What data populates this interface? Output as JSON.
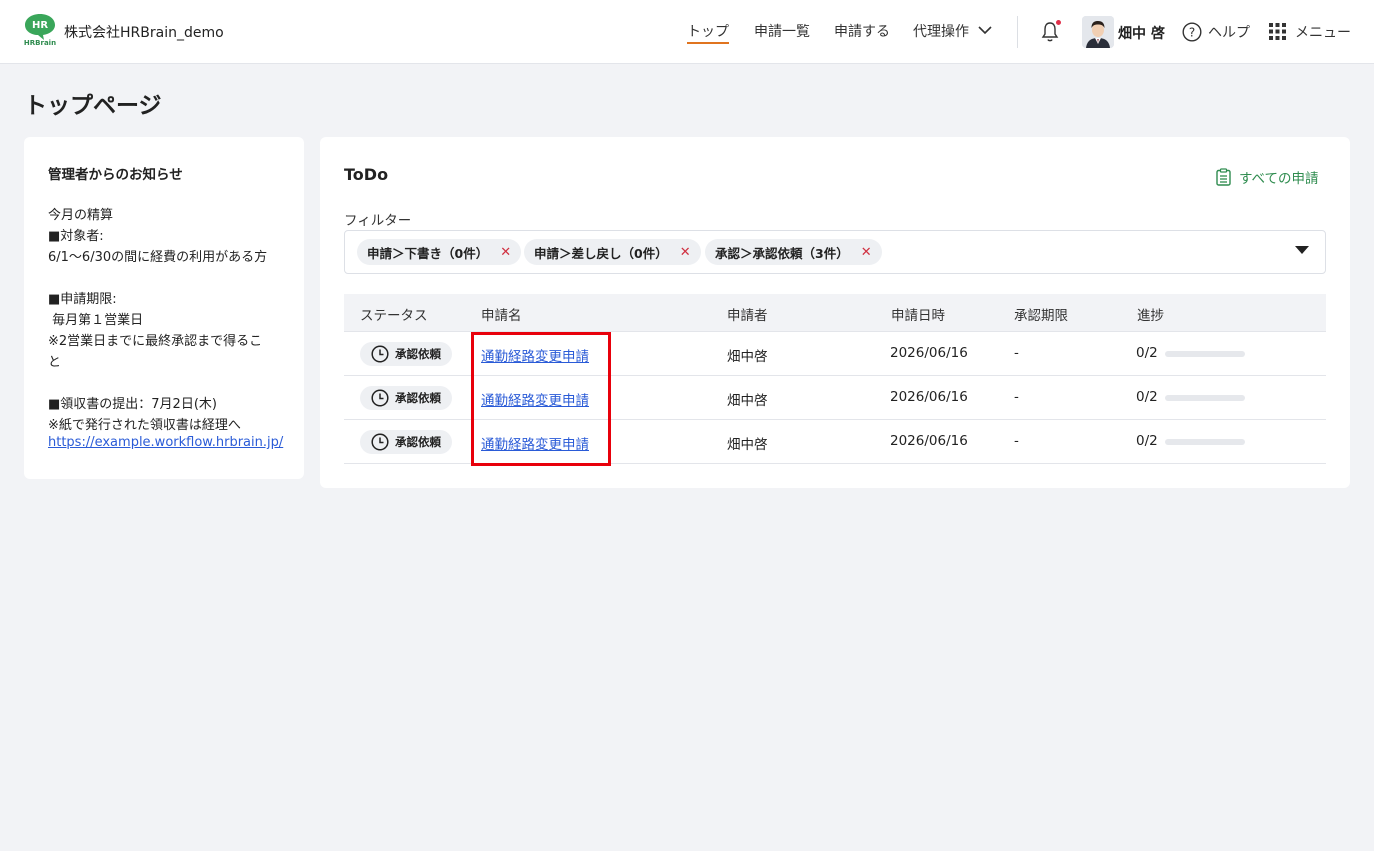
{
  "header": {
    "logo_text_top": "HR",
    "logo_text_bottom": "HRBrain",
    "company": "株式会社HRBrain_demo",
    "nav": [
      "トップ",
      "申請一覧",
      "申請する",
      "代理操作"
    ],
    "username": "畑中 啓",
    "help": "ヘルプ",
    "menu": "メニュー"
  },
  "page_title": "トップページ",
  "notice": {
    "title": "管理者からのお知らせ",
    "lines": [
      "今月の精算",
      "■対象者:",
      "6/1〜6/30の間に経費の利用がある方",
      "■申請期限:",
      " 毎月第１営業日",
      "※2営業日までに最終承認まで得るこ",
      "と",
      "■領収書の提出：7月2日(木)",
      "※紙で発行された領収書は経理へ"
    ],
    "link": "https://example.workflow.hrbrain.jp/"
  },
  "todo": {
    "title": "ToDo",
    "all_link": "すべての申請",
    "filter_label": "フィルター",
    "chips": [
      "申請＞下書き（0件）",
      "申請＞差し戻し（0件）",
      "承認＞承認依頼（3件）"
    ],
    "columns": [
      "ステータス",
      "申請名",
      "申請者",
      "申請日時",
      "承認期限",
      "進捗"
    ],
    "rows": [
      {
        "status": "承認依頼",
        "name": "通勤経路変更申請",
        "applicant": "畑中啓",
        "date": "2026/06/16",
        "deadline": "-",
        "progress": "0/2",
        "progress_value": 0
      },
      {
        "status": "承認依頼",
        "name": "通勤経路変更申請",
        "applicant": "畑中啓",
        "date": "2026/06/16",
        "deadline": "-",
        "progress": "0/2",
        "progress_value": 0
      },
      {
        "status": "承認依頼",
        "name": "通勤経路変更申請",
        "applicant": "畑中啓",
        "date": "2026/06/16",
        "deadline": "-",
        "progress": "0/2",
        "progress_value": 0
      }
    ]
  },
  "colors": {
    "brand_green": "#2f8c4f",
    "nav_active_underline": "#e0741f",
    "link_blue": "#2a5bd7",
    "highlight_red": "#e8000b",
    "chip_close_red": "#d03040"
  }
}
